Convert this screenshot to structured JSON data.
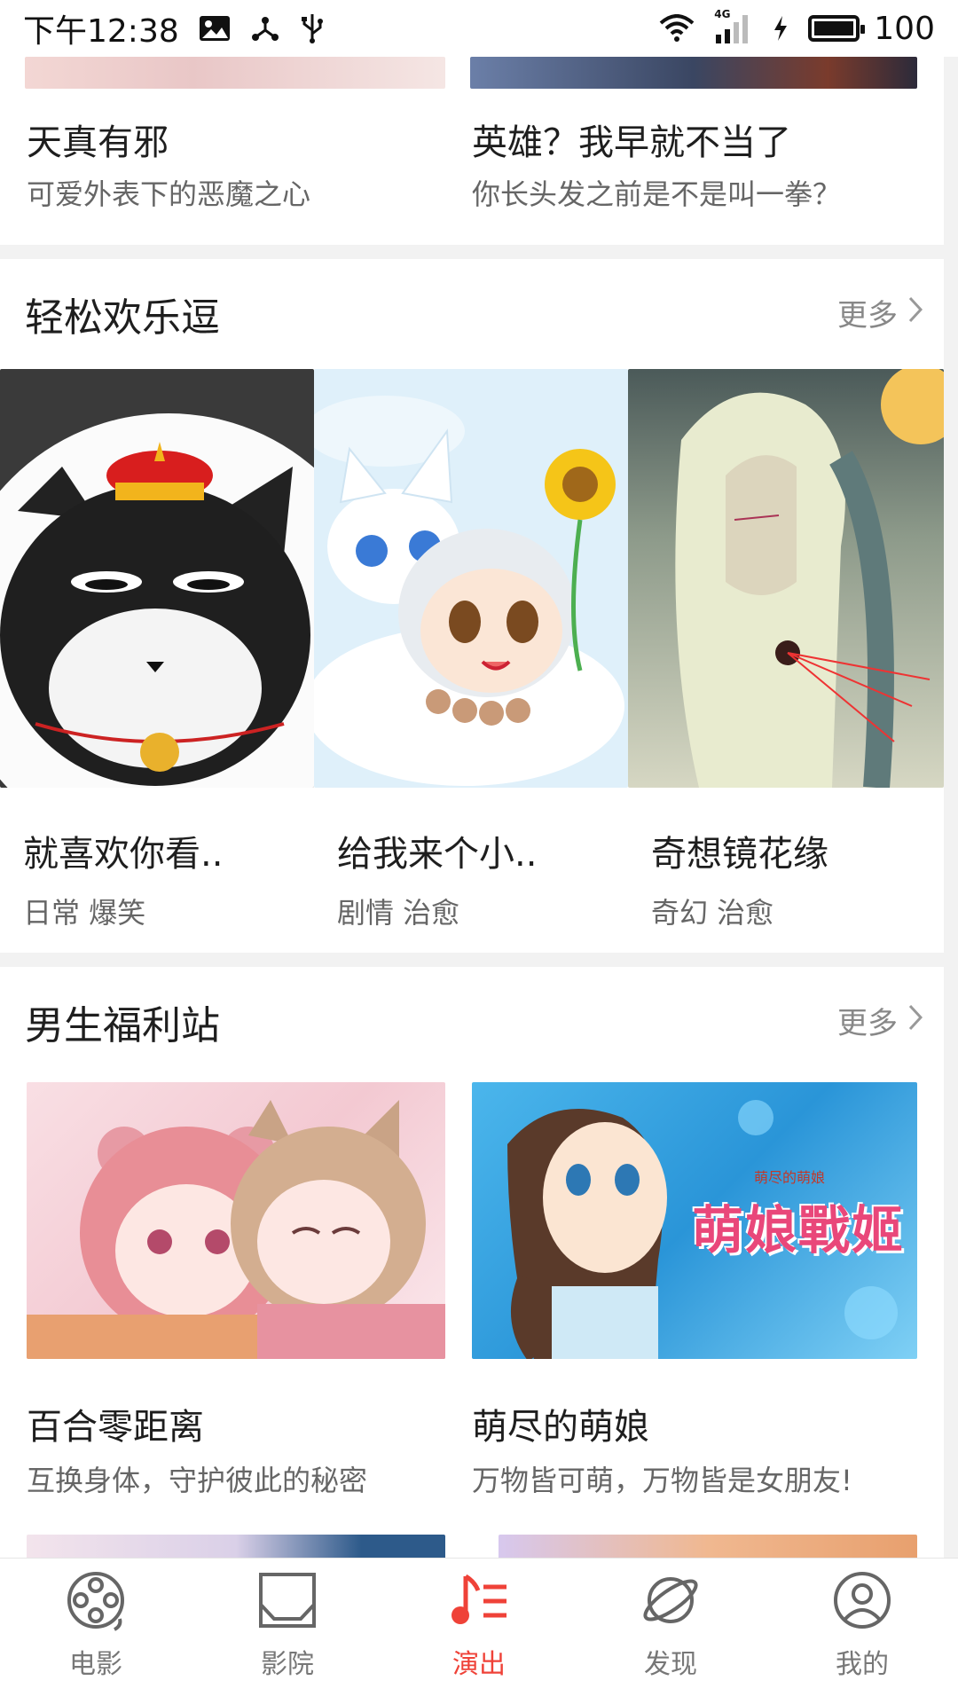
{
  "status_bar": {
    "time": "下午12:38",
    "network": "4G",
    "battery": "100"
  },
  "top_section": {
    "items": [
      {
        "title": "天真有邪",
        "subtitle": "可爱外表下的恶魔之心"
      },
      {
        "title": "英雄？我早就不当了",
        "subtitle": "你长头发之前是不是叫一拳？"
      }
    ]
  },
  "funny_section": {
    "title": "轻松欢乐逗",
    "more": "更多",
    "items": [
      {
        "title": "就喜欢你看..",
        "tags": "日常 爆笑"
      },
      {
        "title": "给我来个小..",
        "tags": "剧情 治愈"
      },
      {
        "title": "奇想镜花缘",
        "tags": "奇幻 治愈"
      }
    ]
  },
  "boys_section": {
    "title": "男生福利站",
    "more": "更多",
    "items": [
      {
        "title": "百合零距离",
        "subtitle": "互换身体，守护彼此的秘密"
      },
      {
        "title": "萌尽的萌娘",
        "subtitle": "万物皆可萌，万物皆是女朋友!"
      }
    ],
    "poster_text_small": "萌尽的萌娘",
    "poster_text_big": "萌娘戰姬"
  },
  "bottom_nav": {
    "items": [
      {
        "label": "电影",
        "icon": "film-reel-icon"
      },
      {
        "label": "影院",
        "icon": "cinema-screen-icon"
      },
      {
        "label": "演出",
        "icon": "music-note-icon"
      },
      {
        "label": "发现",
        "icon": "planet-icon"
      },
      {
        "label": "我的",
        "icon": "user-icon"
      }
    ],
    "active_index": 2
  },
  "colors": {
    "accent": "#ef4238"
  }
}
